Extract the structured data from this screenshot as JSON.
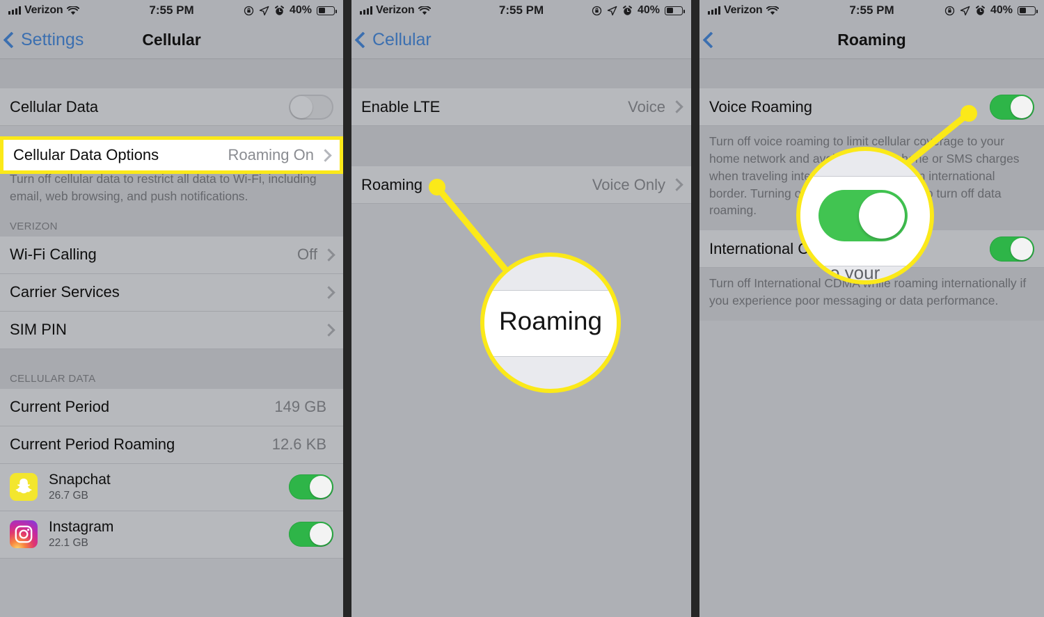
{
  "status_bar": {
    "carrier": "Verizon",
    "time": "7:55 PM",
    "battery_percent": "40%",
    "icons": [
      "signal-bars-icon",
      "wifi-icon",
      "rotation-lock-icon",
      "location-arrow-icon",
      "alarm-clock-icon",
      "battery-icon"
    ]
  },
  "colors": {
    "highlight_yellow": "#fbe919",
    "toggle_on_green": "#2eb548",
    "link_blue": "#3b6fb0",
    "panel_background": "#aeb0b5"
  },
  "panel1": {
    "nav": {
      "back_label": "Settings",
      "title": "Cellular"
    },
    "cellular_data_row": {
      "label": "Cellular Data",
      "toggle_state": "off"
    },
    "highlighted_row": {
      "label": "Cellular Data Options",
      "value": "Roaming On"
    },
    "footnote": "Turn off cellular data to restrict all data to Wi-Fi, including email, web browsing, and push notifications.",
    "carrier_section_header": "VERIZON",
    "carrier_rows": [
      {
        "label": "Wi-Fi Calling",
        "value": "Off"
      },
      {
        "label": "Carrier Services",
        "value": ""
      },
      {
        "label": "SIM PIN",
        "value": ""
      }
    ],
    "data_section_header": "CELLULAR DATA",
    "usage_rows": [
      {
        "label": "Current Period",
        "value": "149 GB"
      },
      {
        "label": "Current Period Roaming",
        "value": "12.6 KB"
      }
    ],
    "apps": [
      {
        "name": "Snapchat",
        "size": "26.7 GB",
        "icon": "snapchat-icon",
        "toggle_state": "on"
      },
      {
        "name": "Instagram",
        "size": "22.1 GB",
        "icon": "instagram-icon",
        "toggle_state": "on"
      }
    ]
  },
  "panel2": {
    "nav": {
      "back_label": "Cellular",
      "title": ""
    },
    "rows": [
      {
        "label": "Enable LTE",
        "value": "Voice"
      },
      {
        "label": "Roaming",
        "value": "Voice Only"
      }
    ],
    "magnifier": {
      "text": "Roaming"
    }
  },
  "panel3": {
    "nav": {
      "back_label": "",
      "title": "Roaming"
    },
    "voice_roaming": {
      "label": "Voice Roaming",
      "toggle_state": "on"
    },
    "voice_roaming_footnote": "Turn off voice roaming to limit cellular coverage to your home network and avoid potential phone or SMS charges when traveling internationally or near an international border. Turning off voice roaming will also turn off data roaming.",
    "international_cdma": {
      "label": "International CDMA",
      "toggle_state": "on"
    },
    "international_cdma_footnote": "Turn off International CDMA while roaming internationally if you experience poor messaging or data performance.",
    "magnifier": {
      "ghost_text": "o your",
      "toggle_state": "on"
    }
  }
}
